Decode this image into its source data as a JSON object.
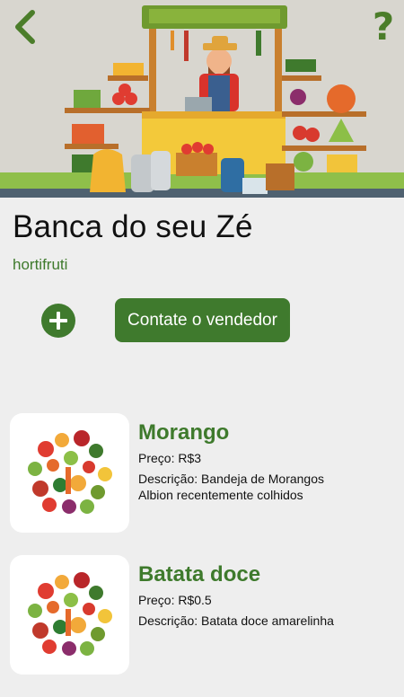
{
  "store": {
    "name": "Banca do seu Zé",
    "category": "hortifruti"
  },
  "actions": {
    "contact_label": "Contate o vendedor"
  },
  "header": {
    "help_label": "?"
  },
  "products": [
    {
      "name": "Morango",
      "price_label": "Preço: R$3",
      "description_label": "Descrição: Bandeja de Morangos Albion recentemente colhidos"
    },
    {
      "name": "Batata doce",
      "price_label": "Preço: R$0.5",
      "description_label": "Descrição: Batata doce amarelinha"
    }
  ],
  "colors": {
    "primary_green": "#3f7a2d",
    "text_green": "#3e7a2c",
    "background": "#eeeeee"
  },
  "icons": [
    "chevron-left-icon",
    "help-icon",
    "plus-icon"
  ]
}
